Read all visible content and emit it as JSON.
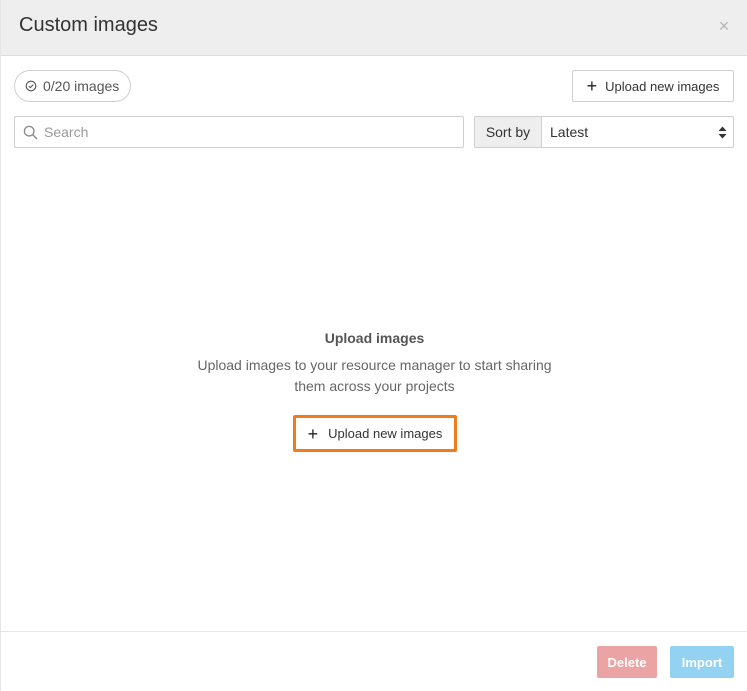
{
  "modal": {
    "title": "Custom images",
    "close_label": "×"
  },
  "toolbar": {
    "image_count": "0/20 images",
    "upload_label": "Upload new images"
  },
  "search": {
    "placeholder": "Search",
    "value": ""
  },
  "sort": {
    "label": "Sort by",
    "selected": "Latest"
  },
  "empty_state": {
    "heading": "Upload images",
    "description": "Upload images to your resource manager to start sharing them across your projects",
    "upload_label": "Upload new images"
  },
  "footer": {
    "delete_label": "Delete",
    "import_label": "Import"
  },
  "colors": {
    "highlight": "#f07b1d",
    "delete_disabled": "#eba3a3",
    "import_disabled": "#93d2f0",
    "header_bg": "#eeeeee"
  },
  "icons": {
    "count": "check-circle-icon",
    "upload": "plus-icon",
    "search": "search-icon",
    "sort": "sort-arrows-icon",
    "close": "close-icon"
  }
}
